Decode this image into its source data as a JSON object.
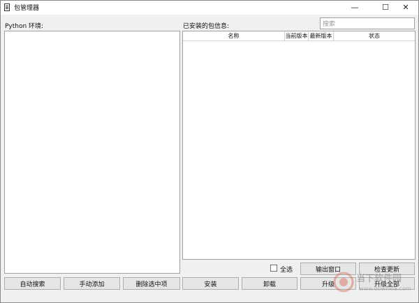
{
  "window": {
    "title": "包管理器",
    "controls": {
      "minimize": "—",
      "maximize": "☐",
      "close": "✕"
    }
  },
  "left": {
    "label": "Python 环境:",
    "buttons": {
      "auto_search": "自动搜索",
      "manual_add": "手动添加",
      "delete_selected": "删除选中项"
    }
  },
  "right": {
    "label": "已安装的包信息:",
    "search_placeholder": "搜索",
    "columns": [
      "名称",
      "当前版本",
      "最新版本",
      "状态"
    ],
    "select_all_label": "全选",
    "buttons": {
      "output_window": "输出窗口",
      "check_updates": "检查更新",
      "install": "安装",
      "uninstall": "卸载",
      "upgrade": "升级",
      "upgrade_all": "升级全部"
    }
  },
  "watermark": {
    "text": "当下软件园",
    "url": "www.downxia.com"
  },
  "colors": {
    "window_bg": "#f0f0f0",
    "panel_bg": "#ffffff",
    "button_bg": "#e6e6e6",
    "border": "#a0a0a0"
  }
}
